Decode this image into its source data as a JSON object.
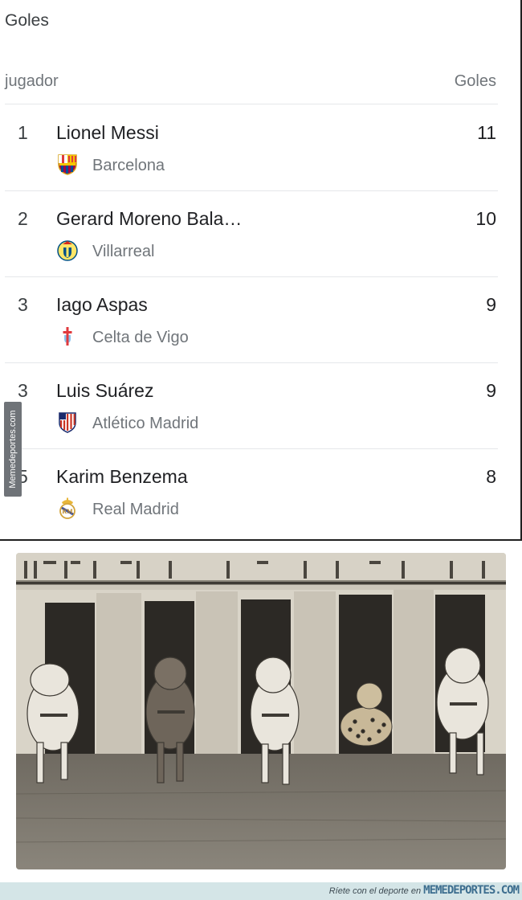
{
  "card": {
    "title": "Goles",
    "columns": {
      "player": "jugador",
      "goals": "Goles"
    },
    "rows": [
      {
        "rank": "1",
        "name": "Lionel Messi",
        "team": "Barcelona",
        "goals": "11",
        "team_icon": "barcelona-crest-icon"
      },
      {
        "rank": "2",
        "name": "Gerard Moreno Bala…",
        "team": "Villarreal",
        "goals": "10",
        "team_icon": "villarreal-crest-icon"
      },
      {
        "rank": "3",
        "name": "Iago Aspas",
        "team": "Celta de Vigo",
        "goals": "9",
        "team_icon": "celta-crest-icon"
      },
      {
        "rank": "3",
        "name": "Luis Suárez",
        "team": "Atlético Madrid",
        "goals": "9",
        "team_icon": "atletico-crest-icon"
      },
      {
        "rank": "5",
        "name": "Karim Benzema",
        "team": "Real Madrid",
        "goals": "8",
        "team_icon": "real-madrid-crest-icon"
      }
    ]
  },
  "watermark": "Memedeportes.com",
  "footer": {
    "tagline": "Ríete con el deporte en",
    "brand": "MEMEDEPORTES.COM"
  },
  "colors": {
    "text_primary": "#202124",
    "text_secondary": "#70757a",
    "divider": "#e5e7ea",
    "footer_bg": "#d4e5e7",
    "footer_brand": "#3d6e8f"
  }
}
